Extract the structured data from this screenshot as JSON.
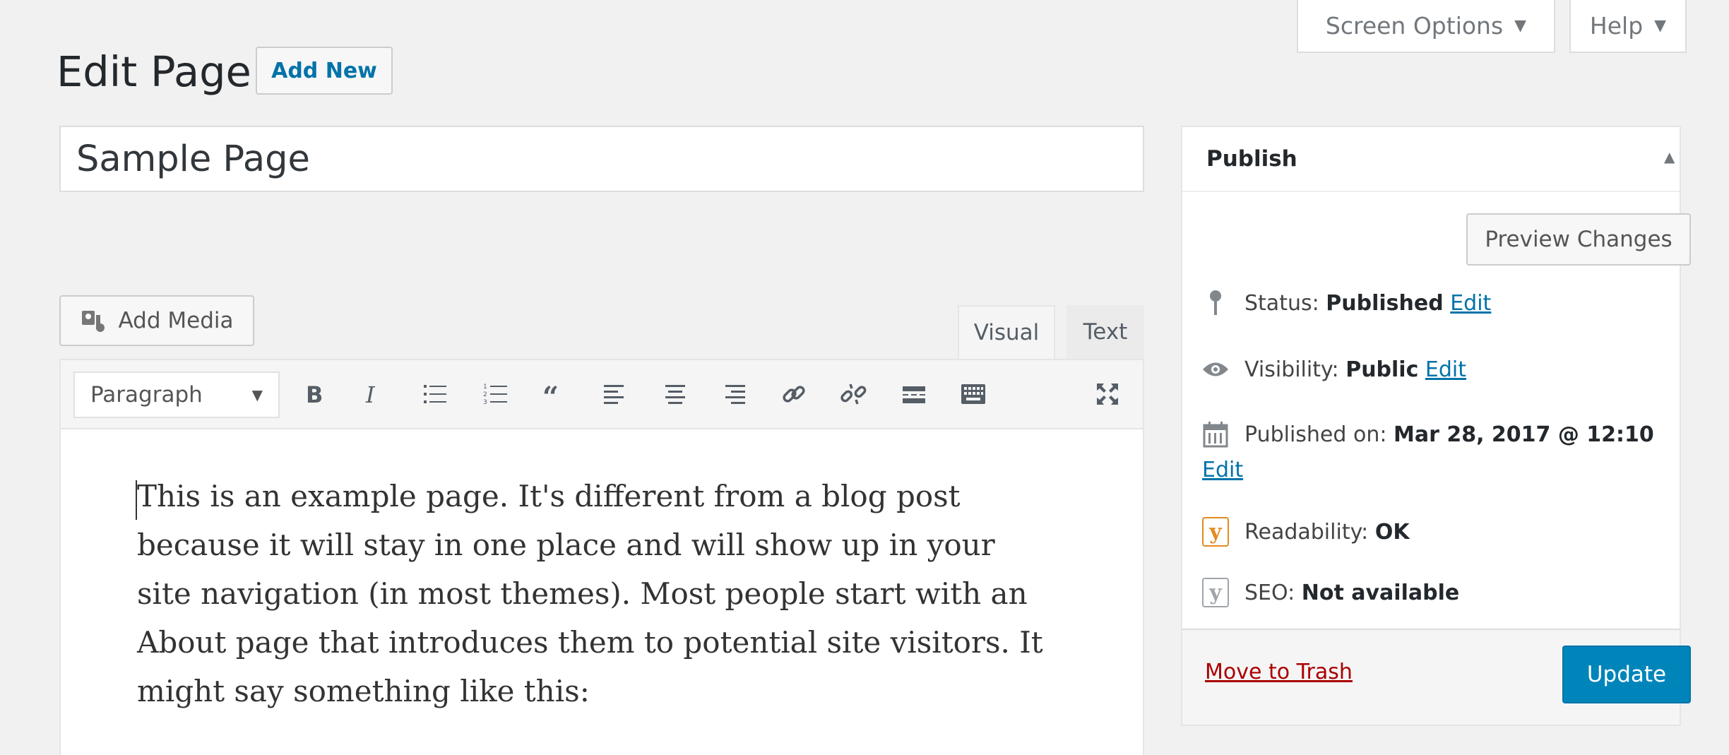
{
  "screen_meta": {
    "screen_options": "Screen Options",
    "help": "Help"
  },
  "heading": {
    "title": "Edit Page",
    "add_new": "Add New"
  },
  "title_field": {
    "value": "Sample Page"
  },
  "editor": {
    "add_media": "Add Media",
    "tabs": {
      "visual": "Visual",
      "text": "Text"
    },
    "format": "Paragraph",
    "content_lines": [
      "This is an example page. It's different from a blog post",
      "because it will stay in one place and will show up in your",
      "site navigation (in most themes). Most people start with an",
      "About page that introduces them to potential site visitors. It",
      "might say something like this:"
    ]
  },
  "publish": {
    "title": "Publish",
    "preview": "Preview Changes",
    "status_label": "Status:",
    "status_value": "Published",
    "visibility_label": "Visibility:",
    "visibility_value": "Public",
    "published_label": "Published on:",
    "published_value": "Mar 28, 2017 @ 12:10",
    "edit": "Edit",
    "readability_label": "Readability:",
    "readability_value": "OK",
    "seo_label": "SEO:",
    "seo_value": "Not available",
    "trash": "Move to Trash",
    "update": "Update"
  },
  "colors": {
    "primary": "#0085ba",
    "link": "#0073aa",
    "trash": "#a00",
    "yoast": "#e38b1f"
  }
}
